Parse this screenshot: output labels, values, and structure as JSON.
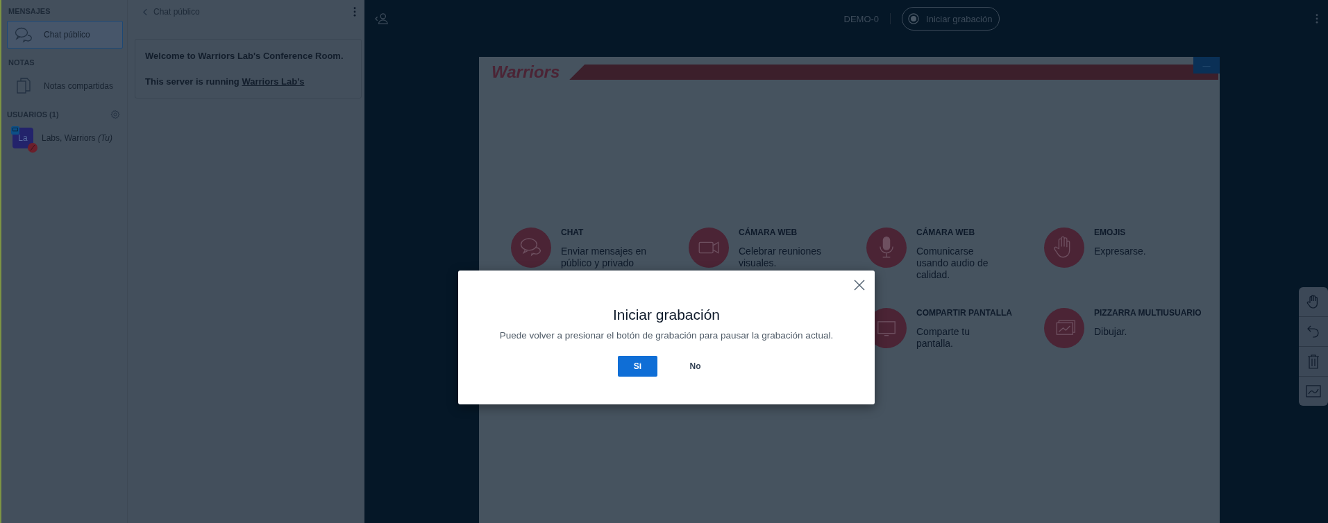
{
  "nav": {
    "sections": [
      {
        "title": "MENSAJES",
        "items": [
          {
            "kind": "chat",
            "label": "Chat público",
            "selected": true
          }
        ]
      },
      {
        "title": "NOTAS",
        "items": [
          {
            "kind": "notes",
            "label": "Notas compartidas",
            "selected": false
          }
        ]
      }
    ],
    "users": {
      "title": "USUARIOS (1)",
      "list": [
        {
          "initials": "La",
          "name": "Labs, Warriors *(Tu)*",
          "presenter": true,
          "muted": true
        }
      ]
    }
  },
  "chat": {
    "title": "Chat público",
    "welcome": "Welcome to Warriors Lab's Conference Room.",
    "running": "This server is running",
    "link": "Warriors Lab's"
  },
  "topbar": {
    "meeting": "DEMO-0",
    "record": "Iniciar grabación"
  },
  "slide": {
    "logo": "Warriors",
    "minimize": "—",
    "rows": [
      {
        "features": [
          {
            "kind": "chat",
            "title": "CHAT",
            "text": "Enviar mensajes en público y privado"
          },
          {
            "kind": "video",
            "title": "CÁMARA WEB",
            "text": "Celebrar reuniones visuales."
          },
          {
            "kind": "mic",
            "title": "CÁMARA WEB",
            "text": "Comunicarse usando audio de calidad."
          },
          {
            "kind": "hand",
            "title": "EMOJIS",
            "text": "Expresarse."
          }
        ]
      },
      {
        "features": [
          {
            "kind": "screen",
            "title": "COMPARTIR PANTALLA",
            "text": "Comparte tu pantalla."
          },
          {
            "kind": "board",
            "title": "PIZZARRA MULTIUSUARIO",
            "text": "Dibujar."
          }
        ]
      }
    ]
  },
  "tools": [
    {
      "kind": "hand"
    },
    {
      "kind": "undo"
    },
    {
      "kind": "trash"
    },
    {
      "kind": "chart"
    }
  ],
  "modal": {
    "title": "Iniciar grabación",
    "text": "Puede volver a presionar el botón de grabación para pausar la grabación actual.",
    "yes": "Si",
    "no": "No"
  }
}
